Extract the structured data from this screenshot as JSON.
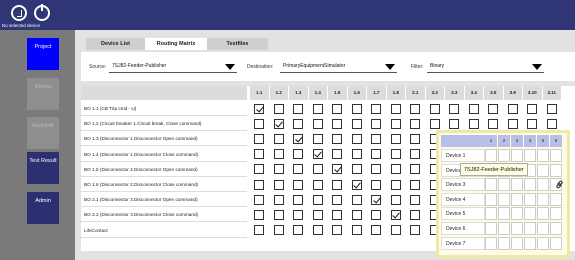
{
  "topbar": {
    "no_device": "No selected device"
  },
  "sidebar": {
    "project": "Project",
    "device": "Device",
    "redistrib": "Redistrib",
    "test_result": "Test Result",
    "admin": "Admin"
  },
  "tabs": [
    "Device List",
    "Routing Matrix",
    "Testfiles"
  ],
  "filters": {
    "source_label": "Source:",
    "source_value": "7SJ82-Feeder-Publisher",
    "destination_label": "Destination:",
    "destination_value": "PrimaryEquipmentSimulator",
    "filter_label": "Filter:",
    "filter_value": "Binary"
  },
  "matrix": {
    "columns": [
      "1.1",
      "1.2",
      "1.3",
      "1.4",
      "1.5",
      "1.6",
      "1.7",
      "1.8",
      "2.1",
      "3.2",
      "3.3",
      "3.4",
      "3.5",
      "3.9",
      "3.10",
      "3.11"
    ],
    "rows": [
      {
        "label": "BO 1.1 (CB Trip cmd - U)",
        "checked": [
          0
        ]
      },
      {
        "label": "BO 1.2 (Circuit breaker 1.Circuit break. Close command)",
        "checked": [
          1
        ]
      },
      {
        "label": "BO 1.3 (Disconnector 1.Disconnector Open command)",
        "checked": [
          2
        ]
      },
      {
        "label": "BO 1.4 (Disconnector 1.Disconnector Close command)",
        "checked": [
          3
        ]
      },
      {
        "label": "BO 1.5 (Disconnector 2.Disconnector Open command)",
        "checked": [
          4
        ]
      },
      {
        "label": "BO 1.6 (Disconnector 2.Disconnector Close command)",
        "checked": [
          5
        ]
      },
      {
        "label": "BO 2.1 (Disconnector 3.Disconnector Open command)",
        "checked": [
          6
        ]
      },
      {
        "label": "BO 2.2 (Disconnector 3.Disconnector Close command)",
        "checked": [
          7
        ]
      },
      {
        "label": "LifeContact",
        "checked": []
      }
    ]
  },
  "popup": {
    "columns": [
      "1",
      "2",
      "3",
      "4",
      "5",
      "6"
    ],
    "devices": [
      "Device 1",
      "Device 2",
      "Device 3",
      "Device 4",
      "Device 5",
      "Device 6",
      "Device 7"
    ],
    "tooltip": "7SJ82-Feeder-Publisher"
  }
}
